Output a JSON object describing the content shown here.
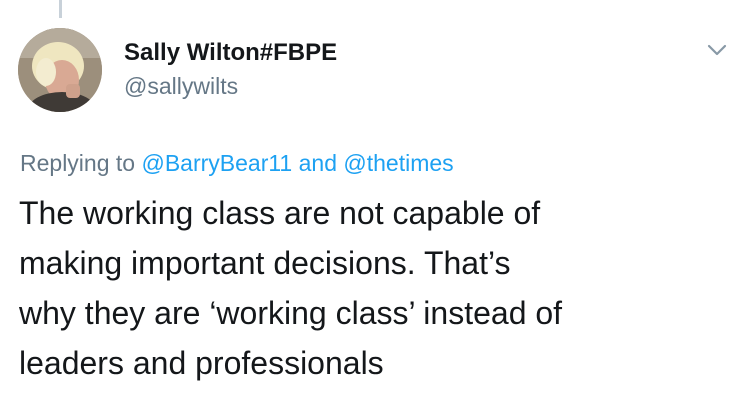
{
  "tweet": {
    "author": {
      "display_name": "Sally Wilton#FBPE",
      "handle": "@sallywilts"
    },
    "menu_icon": "chevron-down-icon",
    "reply_context": {
      "prefix": "Replying to",
      "mention_1": "@BarryBear11",
      "conjunction": "and",
      "mention_2": "@thetimes"
    },
    "text_lines": [
      "The working class are not capable of",
      "making important decisions. That’s",
      "why they are ‘working class’ instead of",
      "leaders and professionals"
    ]
  },
  "colors": {
    "text": "#14171a",
    "secondary": "#657786",
    "link": "#1da1f2",
    "thread_line": "#c8d1d9"
  }
}
